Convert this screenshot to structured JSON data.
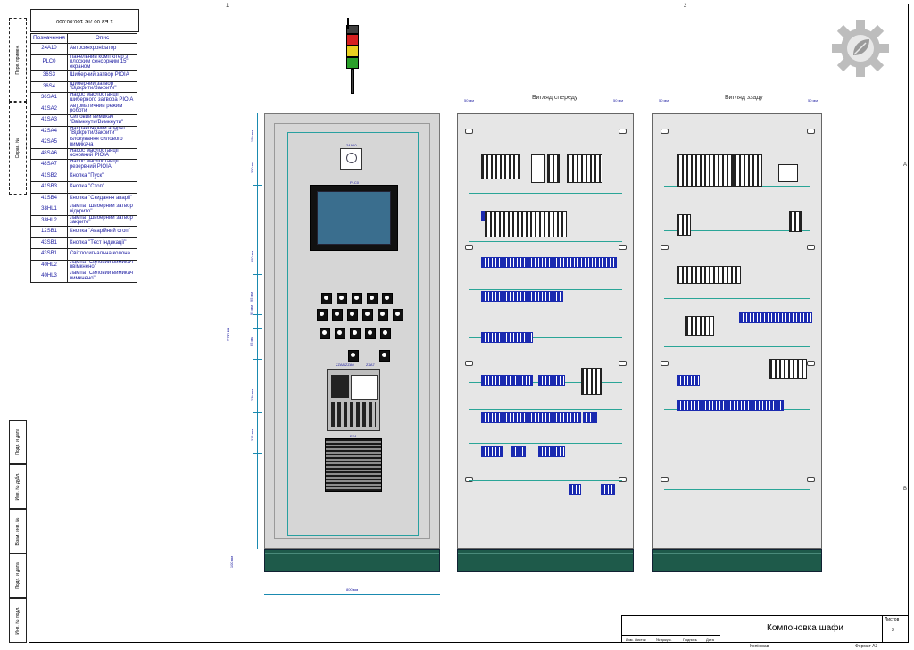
{
  "drawing": {
    "doc_number": "1-ЕЗ-00-ЛЄ-100.00.000",
    "sheet_title": "Компоновка шафи",
    "format_label": "Формат А3",
    "copied_label": "Копіював",
    "sheet_label": "Листов",
    "sheet_number": "3",
    "zone_top": [
      "1",
      "2"
    ],
    "zone_side": [
      "A",
      "B"
    ]
  },
  "legend": {
    "header_code": "Позначення",
    "header_desc": "Опис",
    "rows": [
      {
        "code": "24A10",
        "desc": "Автосинхронізатор"
      },
      {
        "code": "PLC0",
        "desc": "Панельний комп'ютер з плоским сенсорним 15\" екраном"
      },
      {
        "code": "36S3",
        "desc": "Шиберний затвор РІОІА"
      },
      {
        "code": "36S4",
        "desc": "Шиберний затвор \"Відкрити/Закрити\""
      },
      {
        "code": "36SA1",
        "desc": "Насос маслостанції шиберного затвора РІОІА"
      },
      {
        "code": "41SA2",
        "desc": "Автоматичний режим роботи"
      },
      {
        "code": "41SA3",
        "desc": "Силовий вимикач \"Ввімкнути/Вимкнути\""
      },
      {
        "code": "42SA4",
        "desc": "Направляючий апарат \"Відкрити/Закрити\""
      },
      {
        "code": "42SA5",
        "desc": "Блокування силового вимикача"
      },
      {
        "code": "48SA6",
        "desc": "Насос маслостанції основний РІОІА"
      },
      {
        "code": "48SA7",
        "desc": "Насос маслостанції резервний РІОІА"
      },
      {
        "code": "41SB2",
        "desc": "Кнопка \"Пуск\""
      },
      {
        "code": "41SB3",
        "desc": "Кнопка \"Стоп\""
      },
      {
        "code": "41SB4",
        "desc": "Кнопка \"Скидання аварії\""
      },
      {
        "code": "38HL1",
        "desc": "Лампа \"Шиберний затвор відкрито\""
      },
      {
        "code": "38HL2",
        "desc": "Лампа \"Шиберний затвор закрито\""
      },
      {
        "code": "12SB1",
        "desc": "Кнопка \"Аварійний стоп\""
      },
      {
        "code": "43SB1",
        "desc": "Кнопка \"Тест індикації\""
      },
      {
        "code": "43SB1",
        "desc": "Світлосигнальна колона"
      },
      {
        "code": "40HL2",
        "desc": "Лампа \"Силовий вимикач ввімкнено\""
      },
      {
        "code": "40HL3",
        "desc": "Лампа \"Силовий вимикач вимкнено\""
      }
    ]
  },
  "side_labels": {
    "top": [
      "Перв. примен.",
      "Справ. №"
    ],
    "bottom": [
      "Подп. и дата",
      "Инв. № дубл.",
      "Взам. инв. №",
      "Подп. и дата",
      "Инв. № подл."
    ]
  },
  "views": {
    "front_title": "Вигляд спереду",
    "rear_title": "Вигляд ззаду"
  },
  "front_cabinet": {
    "hmi_label": "PLC0",
    "switch_label": "24A10",
    "controller_label": "ZZA8/ZZA0",
    "controller_label2": "ZZA7",
    "fan_label": "EF4"
  },
  "dimensions": {
    "overall_height": "2100 мм",
    "plinth": "100 мм",
    "width": "800 мм",
    "front_segments": [
      "150 мм",
      "300 мм",
      "350 мм",
      "95 мм",
      "95 мм",
      "95 мм",
      "230 мм",
      "315 мм"
    ],
    "mount_top_left": "50 мм",
    "mount_top_right": "50 мм"
  },
  "colors": {
    "tower": [
      "#404040",
      "#d62020",
      "#e8d020",
      "#2aa02a",
      "#404040"
    ],
    "plinth": "#1e5a4a",
    "rail": "#2aa597",
    "component_blue": "#1a2ab0"
  }
}
